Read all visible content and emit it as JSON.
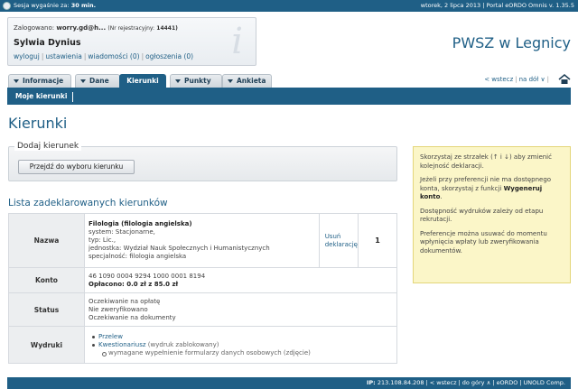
{
  "topbar": {
    "session_prefix": "Sesja wygaśnie za:",
    "session_value": "30 min.",
    "date_info": "wtorek, 2 lipca 2013 | Portal eORDO Omnis v. 1.35.5"
  },
  "login": {
    "logged_label": "Zalogowano:",
    "login_value": "worry.gd@h...",
    "reg_label": "(Nr rejestracyjny:",
    "reg_value": "14441)",
    "user_name": "Sylwia Dynius",
    "links": [
      "wyloguj",
      "ustawienia",
      "wiadomości (0)",
      "ogłoszenia (0)"
    ]
  },
  "brand": "PWSZ w Legnicy",
  "tabs": [
    "Informacje",
    "Dane",
    "Kierunki",
    "Punkty",
    "Ankieta"
  ],
  "crumbs": [
    "< wstecz",
    "na dół ∨"
  ],
  "subnav": {
    "item": "Moje kierunki"
  },
  "page_title": "Kierunki",
  "add_box": {
    "legend": "Dodaj kierunek",
    "button": "Przejdź do wyboru kierunku"
  },
  "list_title": "Lista zadeklarowanych kierunków",
  "table": {
    "name_label": "Nazwa",
    "name_title": "Filologia (filologia angielska)",
    "name_lines": [
      "system: Stacjonarne,",
      "typ: Lic.,",
      "jednostka: Wydział Nauk Społecznych i Humanistycznych",
      "specjalność: filologia angielska"
    ],
    "remove_link": "Usuń deklarację",
    "priority": "1",
    "account_label": "Konto",
    "account_number": "46 1090 0004 9294 1000 0001 8194",
    "paid_label": "Opłacono:",
    "paid_value": "0.0 zł z 85.0 zł",
    "status_label": "Status",
    "status_lines": [
      "Oczekiwanie na opłatę",
      "Nie zweryfikowano",
      "Oczekiwanie na dokumenty"
    ],
    "printouts_label": "Wydruki",
    "printout_1": "Przelew",
    "printout_2": "Kwestionariusz",
    "printout_2_note": "(wydruk zablokowany)",
    "printout_2_sub": "wymagane wypełnienie formularzy danych osobowych (zdjęcie)"
  },
  "note": {
    "p1": "Skorzystaj ze strzałek (↑ i ↓) aby zmienić kolejność deklaracji.",
    "p2_a": "Jeżeli przy preferencji nie ma dostępnego konta, skorzystaj z funkcji",
    "p2_b": "Wygeneruj konto",
    "p2_c": ".",
    "p3": "Dostępność wydruków zależy od etapu rekrutacji.",
    "p4": "Preferencje można usuwać do momentu wpłynięcia wpłaty lub zweryfikowania dokumentów."
  },
  "footer": {
    "ip_label": "IP:",
    "ip_value": "213.108.84.208",
    "links": [
      "< wstecz",
      "do góry ∧",
      "eORDO",
      "UNOLD Comp."
    ]
  }
}
